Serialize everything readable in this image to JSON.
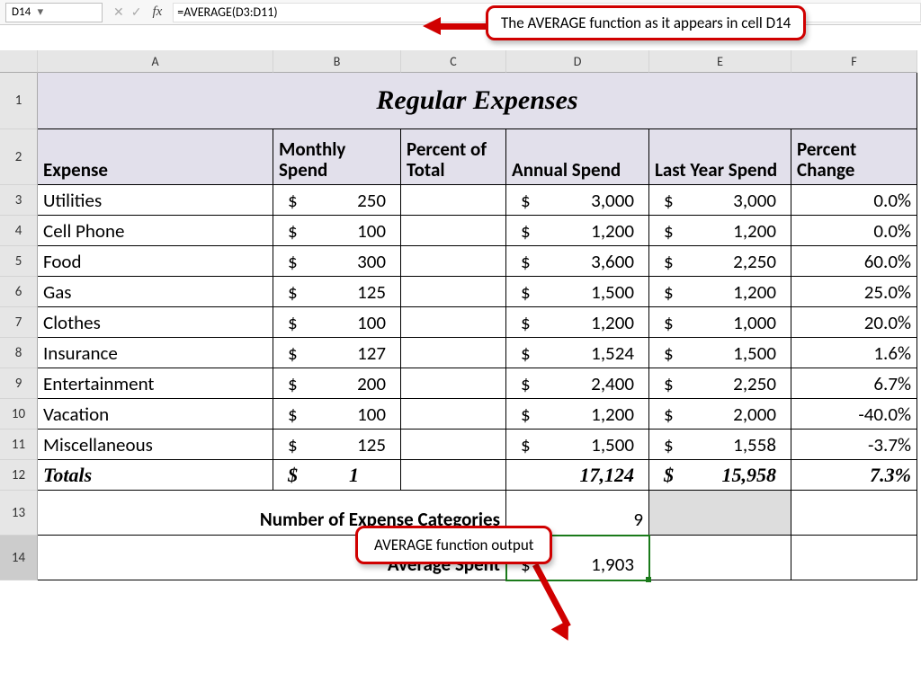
{
  "nameBox": "D14",
  "formula": "=AVERAGE(D3:D11)",
  "columns": [
    "A",
    "B",
    "C",
    "D",
    "E",
    "F"
  ],
  "rows": [
    "1",
    "2",
    "3",
    "4",
    "5",
    "6",
    "7",
    "8",
    "9",
    "10",
    "11",
    "12",
    "13",
    "14"
  ],
  "title": "Regular Expenses",
  "headers": {
    "a": "Expense",
    "b": "Monthly Spend",
    "c": "Percent of Total",
    "d": "Annual Spend",
    "e": "Last Year Spend",
    "f": "Percent Change"
  },
  "data": [
    {
      "exp": "Utilities",
      "monthly": "250",
      "annual": "3,000",
      "last": "3,000",
      "pct": "0.0%"
    },
    {
      "exp": "Cell Phone",
      "monthly": "100",
      "annual": "1,200",
      "last": "1,200",
      "pct": "0.0%"
    },
    {
      "exp": "Food",
      "monthly": "300",
      "annual": "3,600",
      "last": "2,250",
      "pct": "60.0%"
    },
    {
      "exp": "Gas",
      "monthly": "125",
      "annual": "1,500",
      "last": "1,200",
      "pct": "25.0%"
    },
    {
      "exp": "Clothes",
      "monthly": "100",
      "annual": "1,200",
      "last": "1,000",
      "pct": "20.0%"
    },
    {
      "exp": "Insurance",
      "monthly": "127",
      "annual": "1,524",
      "last": "1,500",
      "pct": "1.6%"
    },
    {
      "exp": "Entertainment",
      "monthly": "200",
      "annual": "2,400",
      "last": "2,250",
      "pct": "6.7%"
    },
    {
      "exp": "Vacation",
      "monthly": "100",
      "annual": "1,200",
      "last": "2,000",
      "pct": "-40.0%"
    },
    {
      "exp": "Miscellaneous",
      "monthly": "125",
      "annual": "1,500",
      "last": "1,558",
      "pct": "-3.7%"
    }
  ],
  "totals": {
    "label": "Totals",
    "monthly": "1",
    "annual": "17,124",
    "last": "15,958",
    "pct": "7.3%"
  },
  "row13": {
    "label": "Number of Expense Categories",
    "val": "9"
  },
  "row14": {
    "label": "Average Spent",
    "val": "1,903"
  },
  "callouts": {
    "c1": "The AVERAGE function as it appears in cell D14",
    "c2": "AVERAGE function output"
  },
  "dollar": "$"
}
